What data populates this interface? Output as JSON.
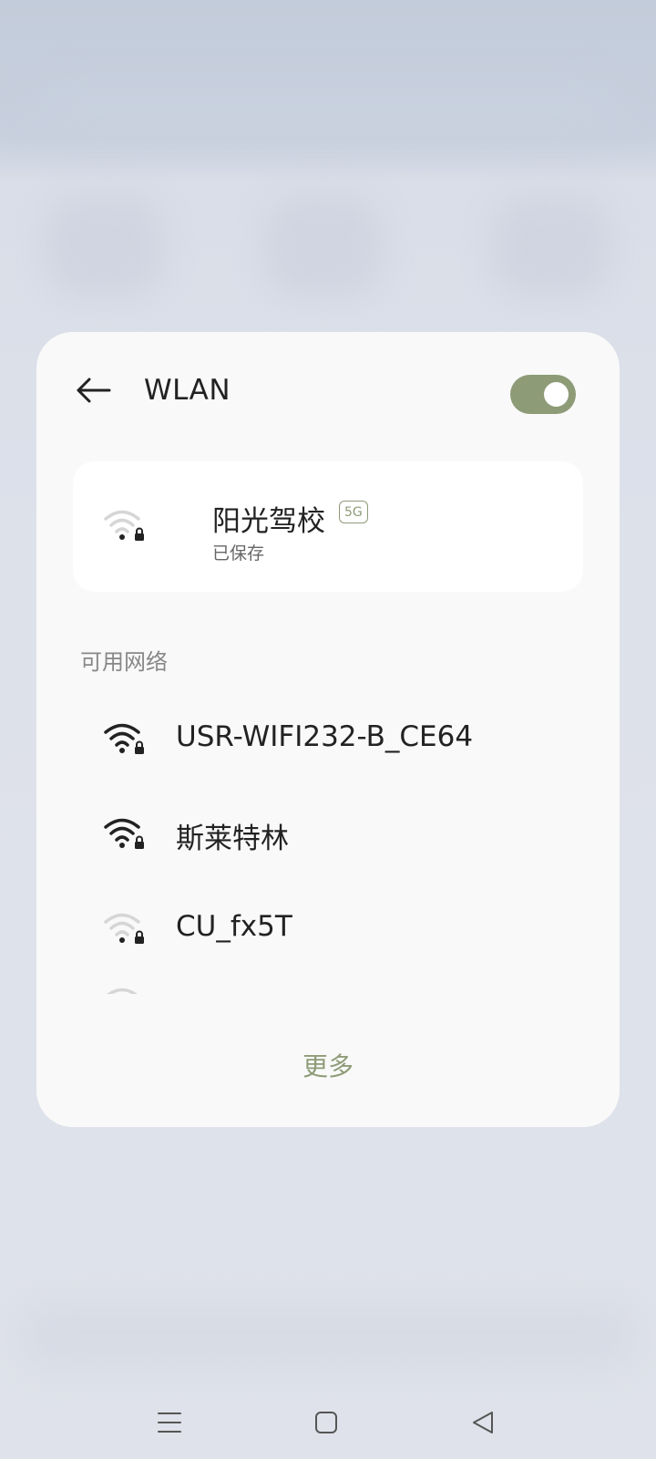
{
  "header": {
    "title": "WLAN",
    "toggle_on": true,
    "accent_color": "#8e9b77"
  },
  "saved_network": {
    "name": "阳光驾校",
    "band_badge": "5G",
    "status": "已保存",
    "signal": "weak",
    "secured": true
  },
  "available_label": "可用网络",
  "networks": [
    {
      "name": "USR-WIFI232-B_CE64",
      "signal": "full",
      "secured": true
    },
    {
      "name": "斯莱特林",
      "signal": "full",
      "secured": true
    },
    {
      "name": "CU_fx5T",
      "signal": "weak",
      "secured": true
    }
  ],
  "more_label": "更多",
  "navbar": {
    "icons": [
      "menu-icon",
      "home-square-icon",
      "back-triangle-icon"
    ]
  }
}
